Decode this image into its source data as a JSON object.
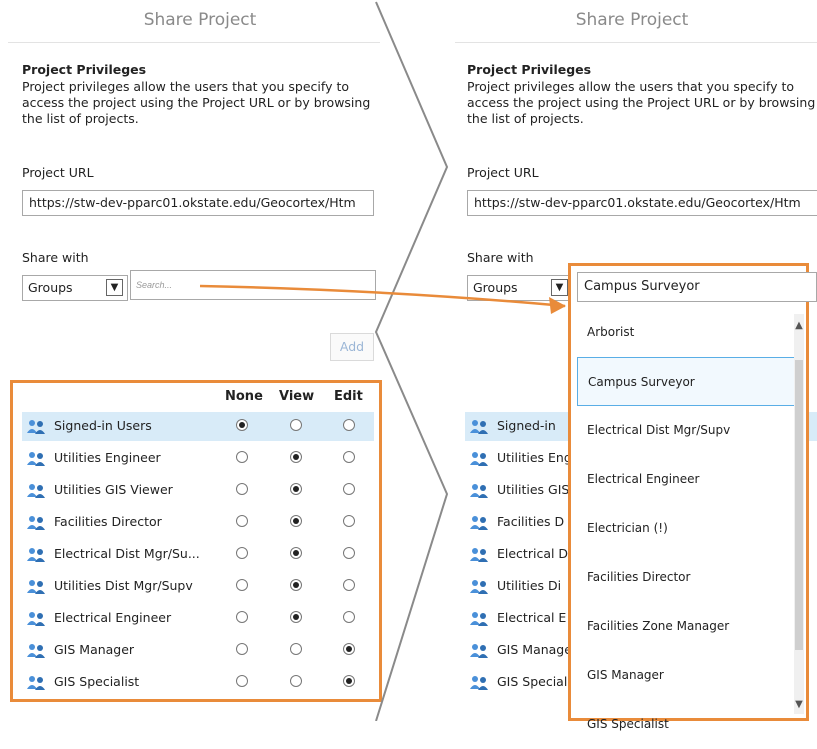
{
  "left": {
    "title": "Share Project",
    "privileges_heading": "Project Privileges",
    "privileges_desc": "Project privileges allow the users that you specify to access the project using the Project URL or by browsing the list of projects.",
    "url_label": "Project URL",
    "url_value": "https://stw-dev-pparc01.okstate.edu/Geocortex/Htm",
    "share_label": "Share with",
    "share_select": "Groups",
    "search_placeholder": "Search...",
    "add_label": "Add",
    "columns": {
      "none": "None",
      "view": "View",
      "edit": "Edit"
    },
    "rows": [
      {
        "name": "Signed-in Users",
        "value": "None",
        "selected": true
      },
      {
        "name": "Utilities Engineer",
        "value": "View"
      },
      {
        "name": "Utilities GIS Viewer",
        "value": "View"
      },
      {
        "name": "Facilities Director",
        "value": "View"
      },
      {
        "name": "Electrical Dist Mgr/Su...",
        "value": "View"
      },
      {
        "name": "Utilities Dist Mgr/Supv",
        "value": "View"
      },
      {
        "name": "Electrical Engineer",
        "value": "View"
      },
      {
        "name": "GIS Manager",
        "value": "Edit"
      },
      {
        "name": "GIS Specialist",
        "value": "Edit"
      }
    ]
  },
  "right": {
    "title": "Share Project",
    "privileges_heading": "Project Privileges",
    "privileges_desc": "Project privileges allow the users that you specify to access the project using the Project URL or by browsing the list of projects.",
    "url_label": "Project URL",
    "url_value": "https://stw-dev-pparc01.okstate.edu/Geocortex/Htm",
    "share_label": "Share with",
    "share_select": "Groups",
    "search_value": "Campus Surveyor",
    "rows_truncated": [
      "Signed-in",
      "Utilities Eng",
      "Utilities GIS",
      "Facilities D",
      "Electrical D",
      "Utilities Di",
      "Electrical E",
      "GIS Manage",
      "GIS Special"
    ],
    "dropdown_items": [
      "Arborist",
      "Campus Surveyor",
      "Electrical Dist Mgr/Supv",
      "Electrical Engineer",
      "Electrician (!)",
      "Facilities Director",
      "Facilities Zone Manager",
      "GIS Manager",
      "GIS Specialist"
    ],
    "highlighted_item": "Campus Surveyor"
  },
  "colors": {
    "highlight_border": "#e98b3a",
    "selected_row": "#d8ebf8",
    "item_highlight": "#5aaee6"
  }
}
